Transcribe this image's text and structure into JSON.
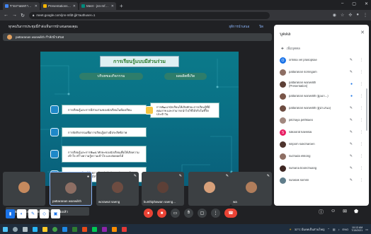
{
  "browser": {
    "tabs": [
      {
        "label": "รายงานผลการประเมิน Document Syst...",
        "color": "#4285f4"
      },
      {
        "label": "Presentations (D1 - Sophanat H...",
        "color": "#f4b400"
      },
      {
        "label": "Meet - jnn-mfdt-jjk",
        "color": "#00897b"
      }
    ],
    "url": "meet.google.com/jnn-mfdt-jjk?authuser=1"
  },
  "meet": {
    "top_left_text": "ทุกคนในการประชุมนี้กำลังเห็นการนำเสนอของคุณ",
    "top_actions": [
      "ยุติการนำเสนอ",
      "ปิด"
    ],
    "presenter_label": "pattaranan wanwilith กำลังนำเสนอ",
    "slide": {
      "title": "การเรียนรู้แบบมีส่วนร่วม",
      "header_left": "บริบทของกิจกรรม",
      "header_right": "ผลผลิตที่เกิด",
      "items": [
        "การเรียนรู้และการมีส่วนร่วมของนักเรียนในห้องเรียน",
        "การจัดกิจกรรมเพื่อการเรียนรู้อย่างมีประสิทธิภาพ",
        "การเรียนรู้และการพัฒนาทักษะของนักเรียนเพื่อให้เกิดความเข้าใจ สร้างความรู้ความเข้าใจ และต่อยอดได้",
        "พัฒนาการเรียนรู้ด้วยการฝึกปฏิบัติจริงผ่านกิจกรรมที่หลากหลาย ทำให้นักเรียนมีส่วนร่วม"
      ],
      "right_item": "การพัฒนานักเรียนให้เกิดทักษะการเรียนรู้ที่มีคุณภาพ และสามารถนำไปใช้ได้จริงในชีวิตประจำวัน"
    },
    "tiles": [
      {
        "name": "pattaranan wanwilith"
      },
      {
        "name": "worawut saeng"
      },
      {
        "name": "kunthiphawan saeng..."
      },
      {
        "name": "wa"
      }
    ],
    "tooltip": "ormika pankrey ได้ออกจากการประชุมแล้ว"
  },
  "panel": {
    "title": "บุคคล",
    "add_label": "เพิ่มบุคคล",
    "people": [
      {
        "name": "ormika vel prasopsae",
        "color": "#1a73e8",
        "initial": "O"
      },
      {
        "name": "pattaranan somngam",
        "color": "#8d6e63",
        "initial": "P"
      },
      {
        "name": "pattaranan wanwilith (Presentation)",
        "color": "#5d4037",
        "initial": "P"
      },
      {
        "name": "pattaranan wanwilith (ผู้ออก...)",
        "color": "#795548",
        "initial": "P"
      },
      {
        "name": "pattaranan wanwilith (ผู้นำเสนอ)",
        "color": "#6d4c41",
        "initial": "P"
      },
      {
        "name": "pitchaya pethkaeo",
        "color": "#a1887f",
        "initial": "P"
      },
      {
        "name": "sakaorat kaewsai",
        "color": "#e91e63",
        "initial": "S"
      },
      {
        "name": "siriporn sukcharoen",
        "color": "#4e342e",
        "initial": "S"
      },
      {
        "name": "suchada ekkong",
        "color": "#8d6e63",
        "initial": "S"
      },
      {
        "name": "sumana boonchuang",
        "color": "#3e2723",
        "initial": "S"
      },
      {
        "name": "surasak somsri",
        "color": "#607d8b",
        "initial": "S"
      }
    ]
  },
  "taskbar": {
    "tray_text": "32°C มีแดดเป็นส่วนใหญ่",
    "lang": "ENG",
    "time": "10:13 AM",
    "date": "7/15/2021"
  }
}
